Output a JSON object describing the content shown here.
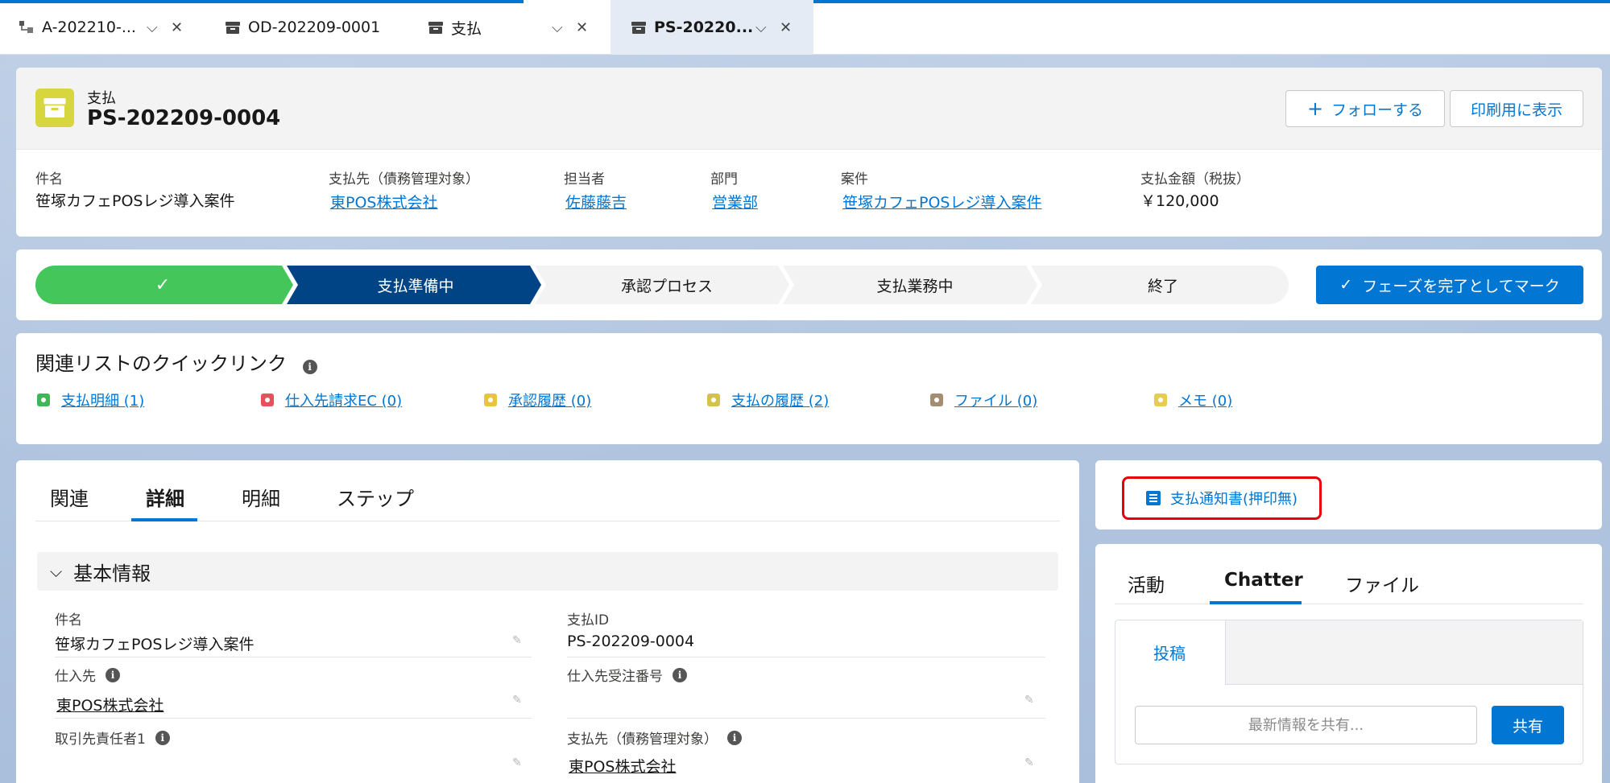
{
  "tabs": [
    {
      "label": "A-202210-...",
      "active": false
    },
    {
      "label": "OD-202209-0001",
      "active": false
    },
    {
      "label": "支払",
      "active": false
    },
    {
      "label": "PS-20220...",
      "active": true
    }
  ],
  "header": {
    "object_type": "支払",
    "title": "PS-202209-0004",
    "follow_label": "フォローする",
    "print_label": "印刷用に表示",
    "fields": [
      {
        "label": "件名",
        "value": "笹塚カフェPOSレジ導入案件"
      },
      {
        "label": "支払先（債務管理対象）",
        "value": "東POS株式会社"
      },
      {
        "label": "担当者",
        "value": "佐藤藤吉"
      },
      {
        "label": "部門",
        "value": "営業部"
      },
      {
        "label": "案件",
        "value": "笹塚カフェPOSレジ導入案件"
      },
      {
        "label": "支払金額（税抜）",
        "value": "￥120,000"
      }
    ]
  },
  "path": {
    "steps": [
      "",
      "支払準備中",
      "承認プロセス",
      "支払業務中",
      "終了"
    ],
    "mark_complete_label": "フェーズを完了としてマーク"
  },
  "quick_links": {
    "title": "関連リストのクイックリンク",
    "items": [
      {
        "label": "支払明細 (1)",
        "color": "#41b658"
      },
      {
        "label": "仕入先請求EC (0)",
        "color": "#e8515b"
      },
      {
        "label": "承認履歴 (0)",
        "color": "#e6c53c"
      },
      {
        "label": "支払の履歴 (2)",
        "color": "#d4c24a"
      },
      {
        "label": "ファイル (0)",
        "color": "#a48d70"
      },
      {
        "label": "メモ (0)",
        "color": "#e6cc4f"
      }
    ]
  },
  "detail": {
    "tabs": [
      "関連",
      "詳細",
      "明細",
      "ステップ"
    ],
    "section_title": "基本情報",
    "fields": {
      "subject": {
        "label": "件名",
        "value": "笹塚カフェPOSレジ導入案件"
      },
      "payment_id": {
        "label": "支払ID",
        "value": "PS-202209-0004"
      },
      "supplier": {
        "label": "仕入先",
        "value": "東POS株式会社"
      },
      "supplier_order_no": {
        "label": "仕入先受注番号",
        "value": ""
      },
      "contact1": {
        "label": "取引先責任者1",
        "value": ""
      },
      "payee": {
        "label": "支払先（債務管理対象）",
        "value": "東POS株式会社"
      }
    }
  },
  "side": {
    "action_label": "支払通知書(押印無)",
    "tabs": [
      "活動",
      "Chatter",
      "ファイル"
    ],
    "post_tab": "投稿",
    "share_placeholder": "最新情報を共有...",
    "share_button": "共有"
  },
  "colors": {
    "brand": "#0176d3",
    "path_complete": "#45c65a",
    "path_current": "#014486",
    "path_incomplete": "#f3f3f3",
    "highlight_red": "#e8000b"
  }
}
